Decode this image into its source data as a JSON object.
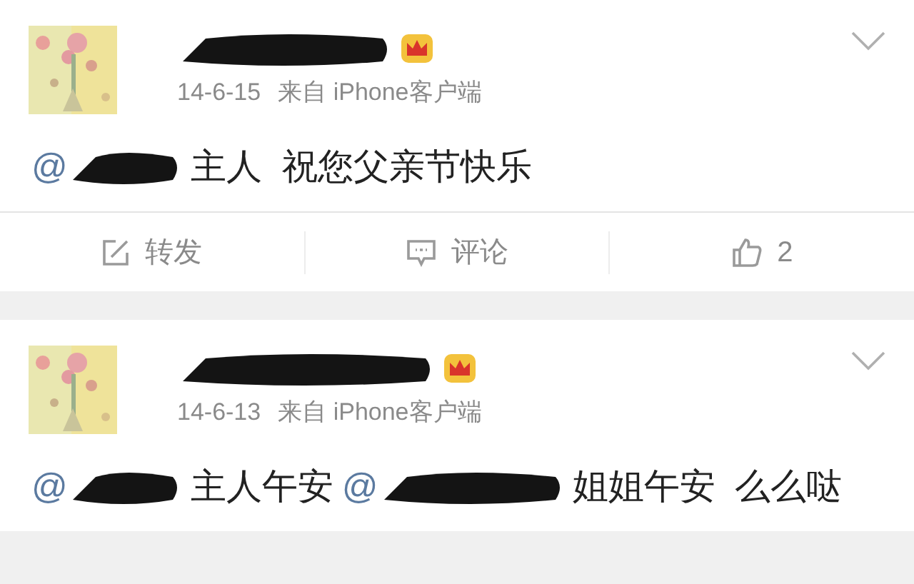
{
  "posts": [
    {
      "date": "14-6-15",
      "source": "来自 iPhone客户端",
      "body": [
        {
          "kind": "mention",
          "text": "@"
        },
        {
          "kind": "text",
          "text": "主人  祝您父亲节快乐"
        }
      ],
      "actions": [
        {
          "kind": "repost",
          "label": "转发"
        },
        {
          "kind": "comment",
          "label": "评论"
        },
        {
          "kind": "like",
          "label": "2"
        }
      ]
    },
    {
      "date": "14-6-13",
      "source": "来自 iPhone客户端",
      "body": [
        {
          "kind": "mention",
          "text": "@"
        },
        {
          "kind": "text",
          "text": "主人午安"
        },
        {
          "kind": "mention",
          "text": "@"
        },
        {
          "kind": "text",
          "text": "姐姐午安  么么哒"
        }
      ]
    }
  ]
}
